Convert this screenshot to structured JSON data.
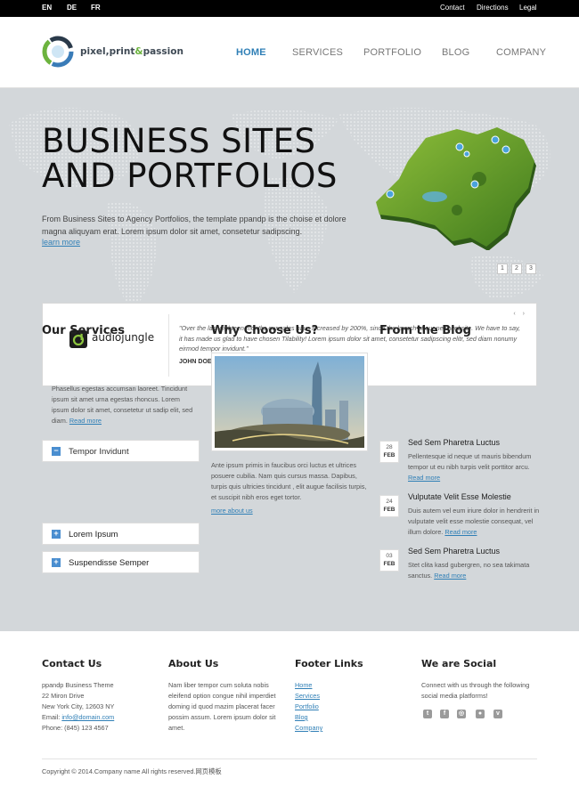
{
  "topbar": {
    "langs": [
      "EN",
      "DE",
      "FR"
    ],
    "links": [
      "Contact",
      "Directions",
      "Legal"
    ]
  },
  "brand": {
    "name_part1": "pixel,print",
    "name_amp": "&",
    "name_part2": "passion",
    "accent": "#6cb33e"
  },
  "nav": {
    "items": [
      "HOME",
      "SERVICES",
      "PORTFOLIO",
      "BLOG",
      "COMPANY"
    ],
    "active": "HOME",
    "active_color": "#2f7fb6"
  },
  "hero": {
    "title_line1": "BUSINESS SITES",
    "title_line2": "AND PORTFOLIOS",
    "description": "From Business Sites to Agency Portfolios, the template ppandp is the choise et dolore magna aliquyam erat. Lorem ipsum dolor sit amet, consetetur sadipscing.",
    "more_link": "learn more",
    "pages": [
      "1",
      "2",
      "3"
    ],
    "background": "#d3d7da"
  },
  "testimonial": {
    "brand": "audiojungle",
    "quote": "\"Over the last eighteen months our sales have increased by 200%, since the launch of our new website. We have to say, it has made us glad to have chosen Tilability! Lorem ipsum dolor sit amet, consetetur sadipscing elitr, sed diam nonumy eirmod tempor invidunt.\"",
    "author": "JOHN DOE",
    "arrows": "‹ ›"
  },
  "services": {
    "title": "Our Services",
    "items": [
      {
        "label": "Tempor Invidunt",
        "icon": "minus-icon",
        "open": true
      },
      {
        "label": "Lorem Ipsum",
        "icon": "plus-icon",
        "open": false
      },
      {
        "label": "Suspendisse Semper",
        "icon": "plus-icon",
        "open": false
      }
    ],
    "open_text": "Phasellus egestas accumsan laoreet. Tincidunt ipsum sit amet urna egestas rhoncus. Lorem ipsum dolor sit amet, consetetur ut sadip elit, sed diam.",
    "read_more": "Read more"
  },
  "why": {
    "title": "Why Choose Us?",
    "text": "Ante ipsum primis in faucibus orci luctus et ultrices posuere cubilia. Nam quis cursus massa. Dapibus, turpis quis ultricies tincidunt , elit augue facilisis turpis, et suscipit nibh eros eget tortor.",
    "more_link": "more about us"
  },
  "blog": {
    "title": "From the Blog",
    "posts": [
      {
        "day": "28",
        "month": "FEB",
        "title": "Sed Sem Pharetra Luctus",
        "excerpt": "Pellentesque id neque ut mauris bibendum tempor ut eu nibh turpis velit porttitor arcu.",
        "more": "Read more"
      },
      {
        "day": "24",
        "month": "FEB",
        "title": "Vulputate Velit Esse Molestie",
        "excerpt": "Duis autem vel eum iriure dolor in hendrerit in vulputate velit esse molestie consequat, vel illum dolore.",
        "more": "Read more"
      },
      {
        "day": "03",
        "month": "FEB",
        "title": "Sed Sem Pharetra Luctus",
        "excerpt": "Stet clita kasd gubergren, no sea takimata sanctus.",
        "more": "Read more"
      }
    ]
  },
  "footer": {
    "contact": {
      "title": "Contact Us",
      "line1": "ppandp Business Theme",
      "line2": "22 Miron Drive",
      "line3": "New York City, 12603 NY",
      "email_label": "Email:",
      "email": "info@domain.com",
      "phone": "Phone: (845) 123 4567"
    },
    "about": {
      "title": "About Us",
      "text": "Nam liber tempor cum soluta nobis eleifend option congue nihil imperdiet doming id quod mazim placerat facer possim assum. Lorem ipsum dolor sit amet."
    },
    "links": {
      "title": "Footer Links",
      "items": [
        "Home",
        "Services",
        "Portfolio",
        "Blog",
        "Company"
      ]
    },
    "social": {
      "title": "We are Social",
      "text": "Connect with us through the following social media platforms!",
      "icons": [
        "twitter-icon",
        "facebook-icon",
        "dribbble-icon",
        "flickr-icon",
        "vimeo-icon"
      ],
      "glyphs": [
        "t",
        "f",
        "◎",
        "●",
        "v"
      ]
    },
    "copyright": "Copyright © 2014.Company name All rights reserved.网页模板"
  }
}
